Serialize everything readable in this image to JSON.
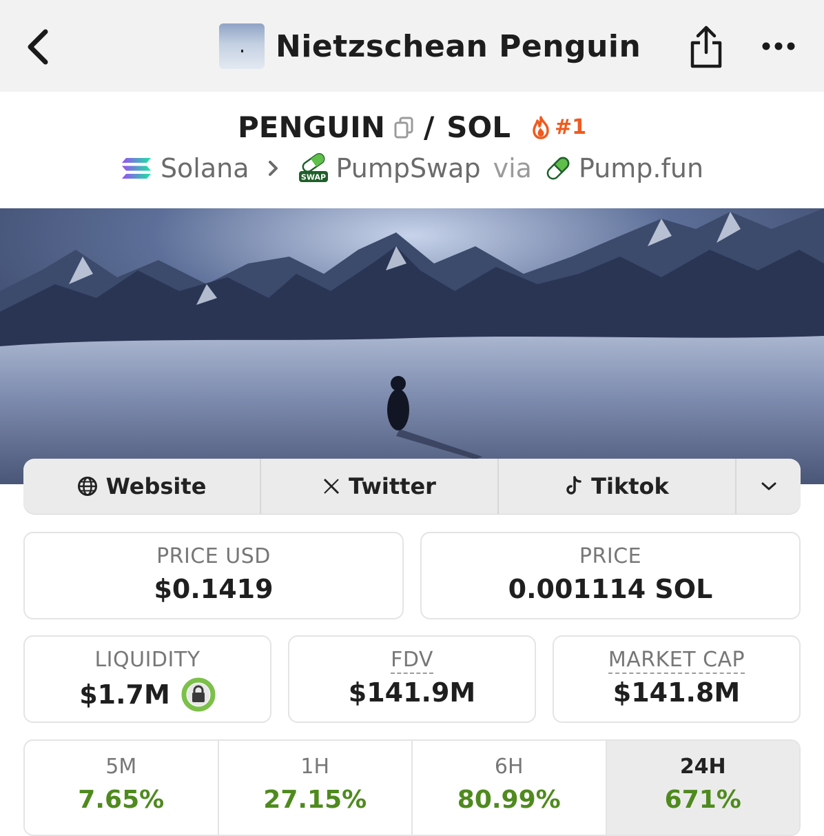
{
  "header": {
    "title": "Nietzschean Penguin"
  },
  "pair": {
    "base": "PENGUIN",
    "separator": "/",
    "quote": "SOL",
    "rank": "#1"
  },
  "chain": {
    "network": "Solana",
    "dex": "PumpSwap",
    "via": "via",
    "launchpad": "Pump.fun",
    "dex_badge": "SWAP"
  },
  "links": {
    "website": "Website",
    "twitter": "Twitter",
    "tiktok": "Tiktok"
  },
  "stats": {
    "price_usd_label": "PRICE USD",
    "price_usd": "$0.1419",
    "price_label": "PRICE",
    "price": "0.001114 SOL",
    "liquidity_label": "LIQUIDITY",
    "liquidity": "$1.7M",
    "fdv_label": "FDV",
    "fdv": "$141.9M",
    "mcap_label": "MARKET CAP",
    "mcap": "$141.8M"
  },
  "timeframes": [
    {
      "label": "5M",
      "value": "7.65%"
    },
    {
      "label": "1H",
      "value": "27.15%"
    },
    {
      "label": "6H",
      "value": "80.99%"
    },
    {
      "label": "24H",
      "value": "671%",
      "active": true
    }
  ],
  "colors": {
    "accent_orange": "#f05a1e",
    "positive_green": "#4f8a1e",
    "lock_green": "#7cc04a"
  },
  "icons": {
    "back": "chevron-left-icon",
    "share": "share-icon",
    "more": "more-horizontal-icon",
    "copy": "copy-icon",
    "rank": "flame-icon",
    "website": "globe-icon",
    "twitter": "x-logo-icon",
    "tiktok": "tiktok-icon",
    "expand": "chevron-down-icon",
    "lock": "lock-icon"
  }
}
